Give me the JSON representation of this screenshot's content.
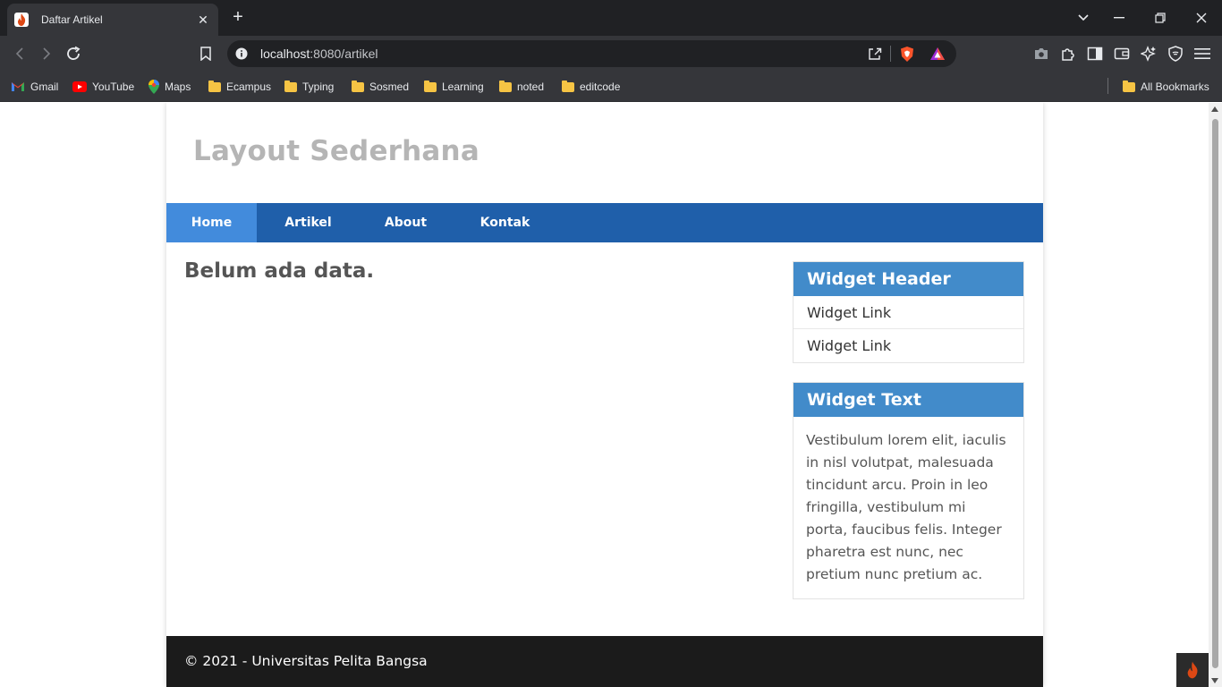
{
  "browser": {
    "tab": {
      "title": "Daftar Artikel"
    },
    "url": {
      "host": "localhost",
      "rest": ":8080/artikel"
    },
    "bookmarks": [
      {
        "label": "Gmail",
        "icon": "gmail-icon"
      },
      {
        "label": "YouTube",
        "icon": "youtube-icon"
      },
      {
        "label": "Maps",
        "icon": "maps-icon"
      },
      {
        "label": "Ecampus",
        "icon": "folder-icon"
      },
      {
        "label": "Typing",
        "icon": "folder-icon"
      },
      {
        "label": "Sosmed",
        "icon": "folder-icon"
      },
      {
        "label": "Learning",
        "icon": "folder-icon"
      },
      {
        "label": "noted",
        "icon": "folder-icon"
      },
      {
        "label": "editcode",
        "icon": "folder-icon"
      }
    ],
    "all_bookmarks": "All Bookmarks"
  },
  "page": {
    "site_title": "Layout Sederhana",
    "nav": [
      {
        "label": "Home",
        "active": true
      },
      {
        "label": "Artikel",
        "active": false
      },
      {
        "label": "About",
        "active": false
      },
      {
        "label": "Kontak",
        "active": false
      }
    ],
    "main_message": "Belum ada data.",
    "widgets": {
      "header": {
        "title": "Widget Header",
        "links": [
          "Widget Link",
          "Widget Link"
        ]
      },
      "text": {
        "title": "Widget Text",
        "body": "Vestibulum lorem elit, iaculis in nisl volutpat, malesuada tincidunt arcu. Proin in leo fringilla, vestibulum mi porta, faucibus felis. Integer pharetra est nunc, nec pretium nunc pretium ac."
      }
    },
    "footer": "© 2021 - Universitas Pelita Bangsa"
  },
  "colors": {
    "nav_bg": "#1f5faa",
    "nav_active": "#428bdc",
    "widget_header": "#428bca",
    "footer_bg": "#1b1b1b"
  }
}
